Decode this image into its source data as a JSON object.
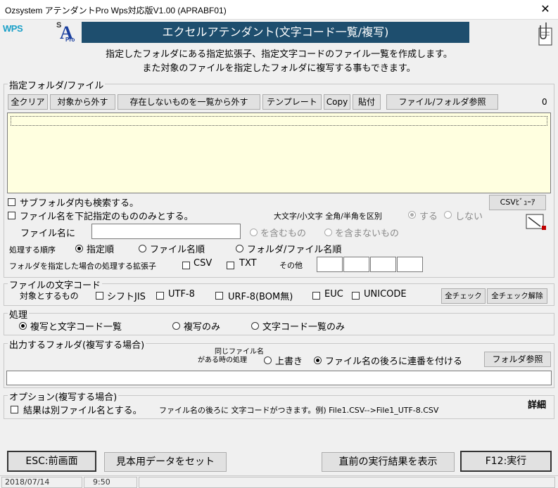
{
  "window": {
    "title": "Ozsystem アテンダントPro Wps対応版V1.00 (APRABF01)",
    "close_glyph": "✕"
  },
  "header": {
    "wps_logo": "WPS",
    "sa_logo": {
      "s": "S",
      "a": "A",
      "pro": "Pro"
    },
    "banner": "エクセルアテンダント(文字コード一覧/複写)",
    "desc_line1": "指定したフォルダにある指定拡張子、指定文字コードのファイル一覧を作成します。",
    "desc_line2": "また対象のファイルを指定したフォルダに複写する事もできます。"
  },
  "folder_group": {
    "legend": "指定フォルダ/ファイル",
    "toolbar": {
      "clear_all": "全クリア",
      "remove_target": "対象から外す",
      "remove_missing": "存在しないものを一覧から外す",
      "template": "テンプレート",
      "copy": "Copy",
      "paste": "貼付",
      "browse": "ファイル/フォルダ参照",
      "count": "0"
    },
    "subfolder_label": "サブフォルダ内も検索する。",
    "csv_viewer": "CSVﾋﾞｭｰｱ",
    "filename_only_label": "ファイル名を下記指定のもののみとする。",
    "case_label": "大文字/小文字 全角/半角を区別",
    "case_yes": "する",
    "case_no": "しない",
    "filename_label": "ファイル名に",
    "filename_value": "",
    "contains": "を含むもの",
    "not_contains": "を含まないもの",
    "order_label": "処理する順序",
    "order_options": [
      "指定順",
      "ファイル名順",
      "フォルダ/ファイル名順"
    ],
    "ext_label": "フォルダを指定した場合の処理する拡張子",
    "ext_csv": "CSV",
    "ext_txt": "TXT",
    "ext_other": "その他"
  },
  "encoding_group": {
    "legend": "ファイルの文字コード",
    "target_label": "対象とするもの",
    "options": [
      "シフトJIS",
      "UTF-8",
      "URF-8(BOM無)",
      "EUC",
      "UNICODE"
    ],
    "check_all": "全チェック",
    "uncheck_all": "全チェック解除"
  },
  "process_group": {
    "legend": "処理",
    "options": [
      "複写と文字コード一覧",
      "複写のみ",
      "文字コード一覧のみ"
    ]
  },
  "output_group": {
    "legend": "出力するフォルダ(複写する場合)",
    "same_name_line1": "同じファイル名",
    "same_name_line2": "がある時の処理",
    "overwrite": "上書き",
    "serial": "ファイル名の後ろに連番を付ける",
    "browse": "フォルダ参照",
    "path_value": ""
  },
  "option_group": {
    "legend": "オプション(複写する場合)",
    "detail": "詳細",
    "separate_label": "結果は別ファイル名とする。",
    "note": "ファイル名の後ろに 文字コードがつきます。例) File1.CSV-->File1_UTF-8.CSV"
  },
  "bottom": {
    "esc": "ESC:前画面",
    "sample": "見本用データをセット",
    "last_result": "直前の実行結果を表示",
    "run": "F12:実行"
  },
  "statusbar": {
    "date": "2018/07/14",
    "time": "9:50"
  }
}
